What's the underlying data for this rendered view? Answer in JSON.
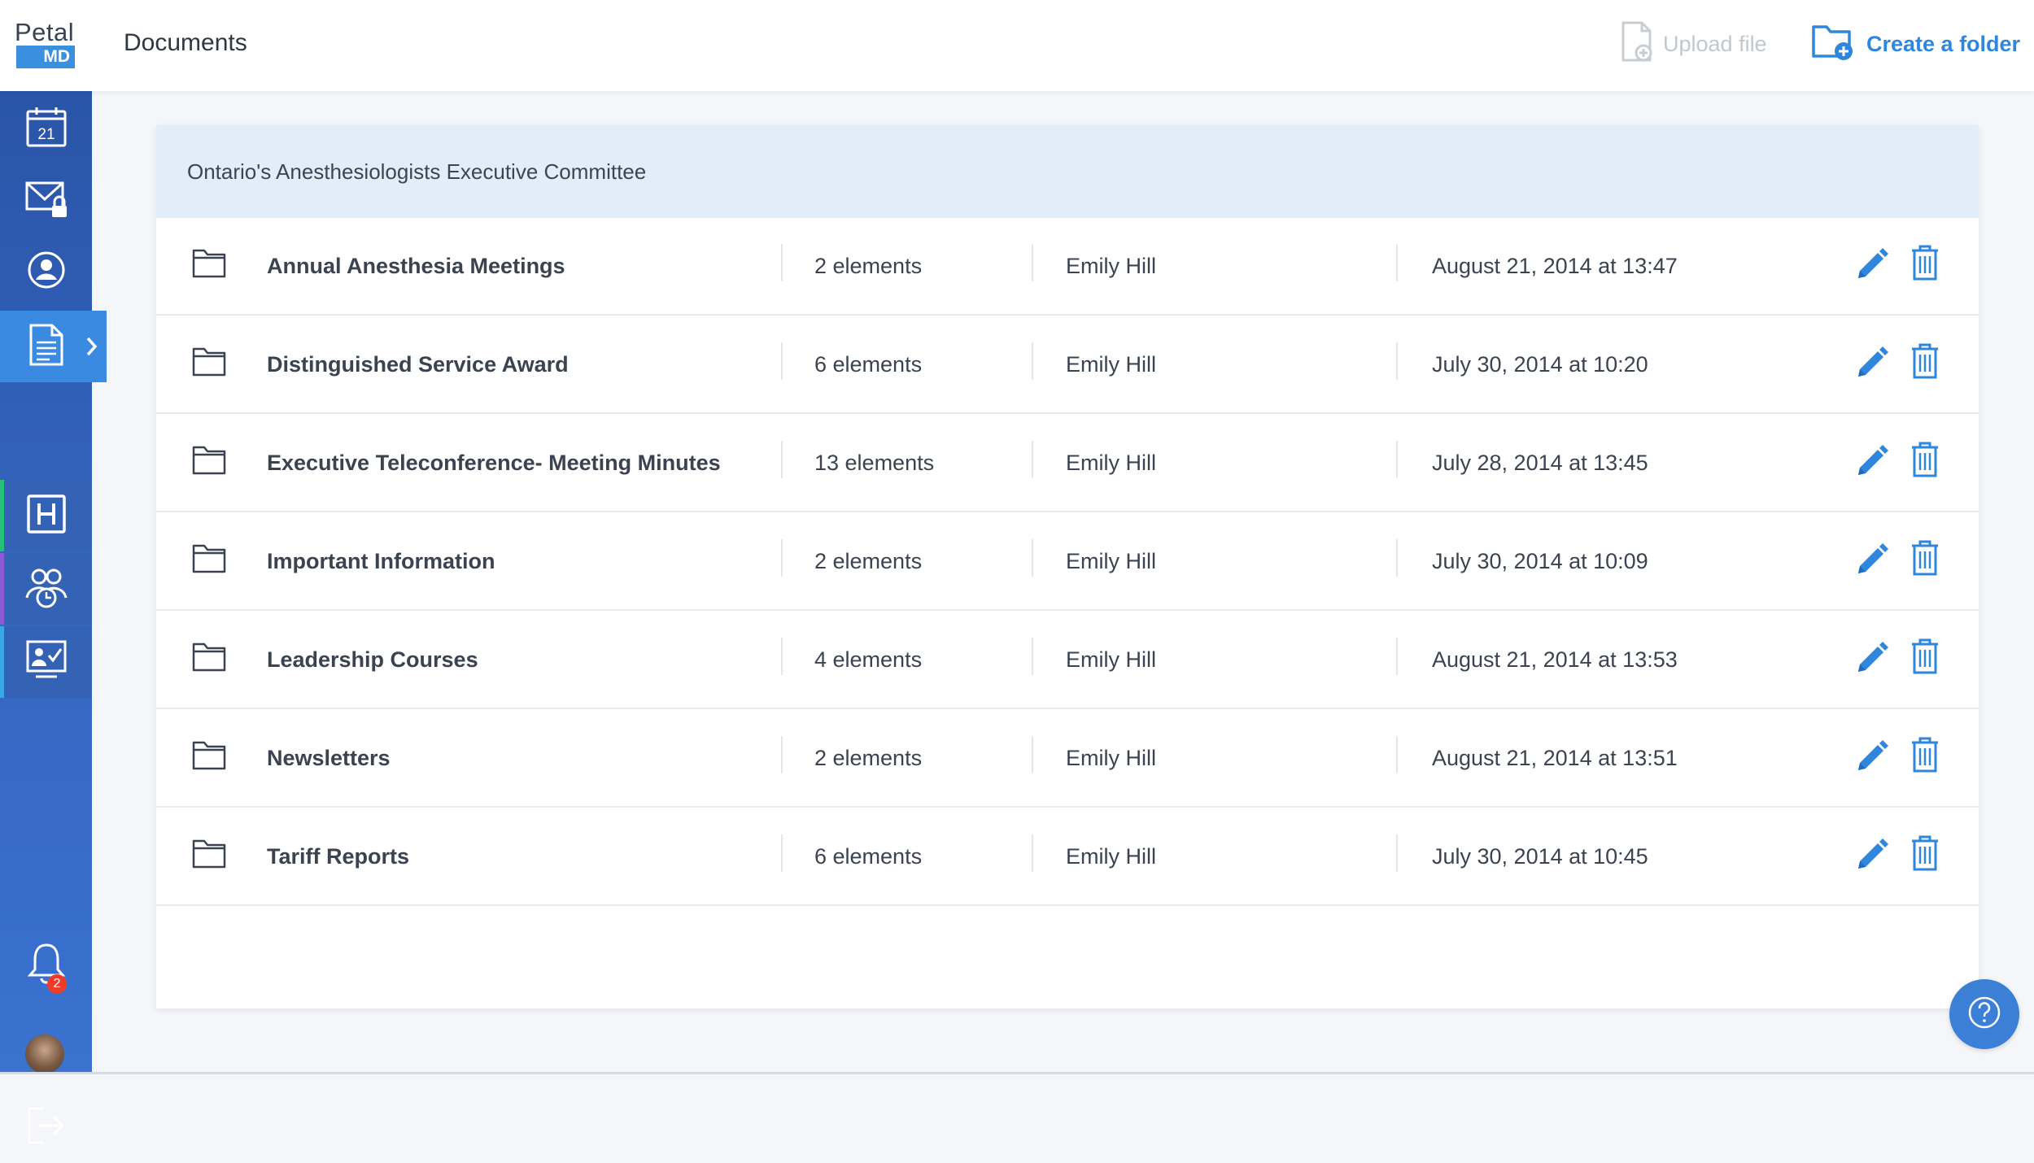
{
  "app": {
    "logo_top": "Petal",
    "logo_bottom": "MD",
    "page_title": "Documents"
  },
  "toolbar": {
    "upload_label": "Upload file",
    "create_folder_label": "Create a folder"
  },
  "sidebar": {
    "calendar_day": "21",
    "notification_count": "2",
    "items": [
      {
        "icon": "calendar-icon"
      },
      {
        "icon": "secure-mail-icon"
      },
      {
        "icon": "profile-icon"
      },
      {
        "icon": "documents-icon",
        "active": true
      },
      {
        "icon": "hospital-icon",
        "accent": "#27c07a"
      },
      {
        "icon": "group-icon",
        "accent": "#8c5ad6"
      },
      {
        "icon": "presentation-icon",
        "accent": "#37a7e8"
      },
      {
        "icon": "bell-icon"
      },
      {
        "icon": "avatar"
      },
      {
        "icon": "logout-icon"
      }
    ]
  },
  "documents": {
    "group_title": "Ontario's Anesthesiologists Executive Committee",
    "folders": [
      {
        "name": "Annual Anesthesia Meetings",
        "count": "2 elements",
        "owner": "Emily Hill",
        "date": "August 21, 2014 at 13:47"
      },
      {
        "name": "Distinguished Service Award",
        "count": "6 elements",
        "owner": "Emily Hill",
        "date": "July 30, 2014 at 10:20"
      },
      {
        "name": "Executive Teleconference- Meeting Minutes",
        "count": "13 elements",
        "owner": "Emily Hill",
        "date": "July 28, 2014 at 13:45"
      },
      {
        "name": "Important Information",
        "count": "2 elements",
        "owner": "Emily Hill",
        "date": "July 30, 2014 at 10:09"
      },
      {
        "name": "Leadership Courses",
        "count": "4 elements",
        "owner": "Emily Hill",
        "date": "August 21, 2014 at 13:53"
      },
      {
        "name": "Newsletters",
        "count": "2 elements",
        "owner": "Emily Hill",
        "date": "August 21, 2014 at 13:51"
      },
      {
        "name": "Tariff Reports",
        "count": "6 elements",
        "owner": "Emily Hill",
        "date": "July 30, 2014 at 10:45"
      }
    ]
  },
  "colors": {
    "accent": "#2f86dd",
    "sidebar": "#2f5db6",
    "header_band": "#e1edf8"
  }
}
